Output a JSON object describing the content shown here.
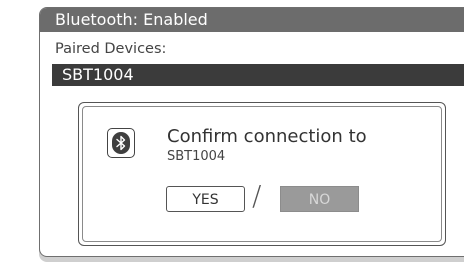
{
  "window": {
    "title": "Bluetooth: Enabled"
  },
  "devices": {
    "label": "Paired Devices:",
    "selected": "SBT1004"
  },
  "dialog": {
    "icon": "bluetooth-icon",
    "message": "Confirm connection to",
    "device": "SBT1004",
    "yes_label": "YES",
    "separator": "/",
    "no_label": "NO"
  }
}
